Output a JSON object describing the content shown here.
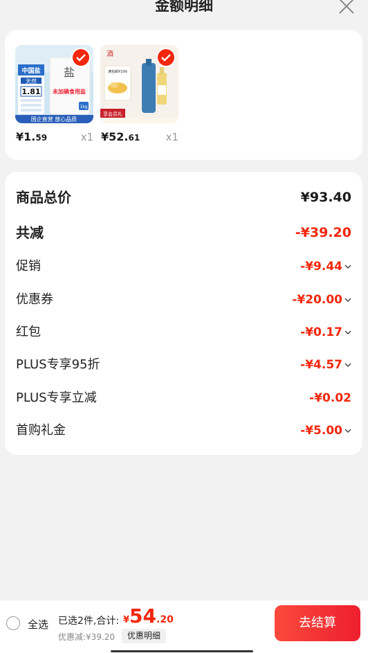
{
  "header": {
    "title": "金额明细"
  },
  "products": [
    {
      "price_symbol": "¥",
      "price_int": "1.",
      "price_dec": "59",
      "qty": "x1",
      "thumb_texts": {
        "badge": "中国盐",
        "badge2": "天然",
        "price_tag": "1.81",
        "product_label": "未加碘食用盐",
        "banner": "国企直营 放心品质",
        "weight": "1kg"
      }
    },
    {
      "price_symbol": "¥",
      "price_int": "52.",
      "price_dec": "61",
      "qty": "x1",
      "thumb_texts": {
        "promo": "满包邮¥299",
        "banner": "享会员礼"
      }
    }
  ],
  "summary": {
    "total_label": "商品总价",
    "total_value": "¥93.40",
    "reduce_label": "共减",
    "reduce_value": "-¥39.20",
    "items": [
      {
        "label": "促销",
        "value": "-¥9.44",
        "expandable": true
      },
      {
        "label": "优惠券",
        "value": "-¥20.00",
        "expandable": true
      },
      {
        "label": "红包",
        "value": "-¥0.17",
        "expandable": true
      },
      {
        "label": "PLUS专享95折",
        "value": "-¥4.57",
        "expandable": true
      },
      {
        "label": "PLUS专享立减",
        "value": "-¥0.02",
        "expandable": false
      },
      {
        "label": "首购礼金",
        "value": "-¥5.00",
        "expandable": true
      }
    ]
  },
  "footer": {
    "select_all": "全选",
    "selected_text": "已选2件,合计:",
    "sum_symbol": "¥",
    "sum_int": "54",
    "sum_dec": ".20",
    "discount_text": "优惠减:¥39.20",
    "detail_button": "优惠明细",
    "checkout_button": "去结算"
  },
  "colors": {
    "accent": "#f2270c",
    "checkout_start": "#fa4a3c",
    "checkout_end": "#ee1f2f"
  }
}
